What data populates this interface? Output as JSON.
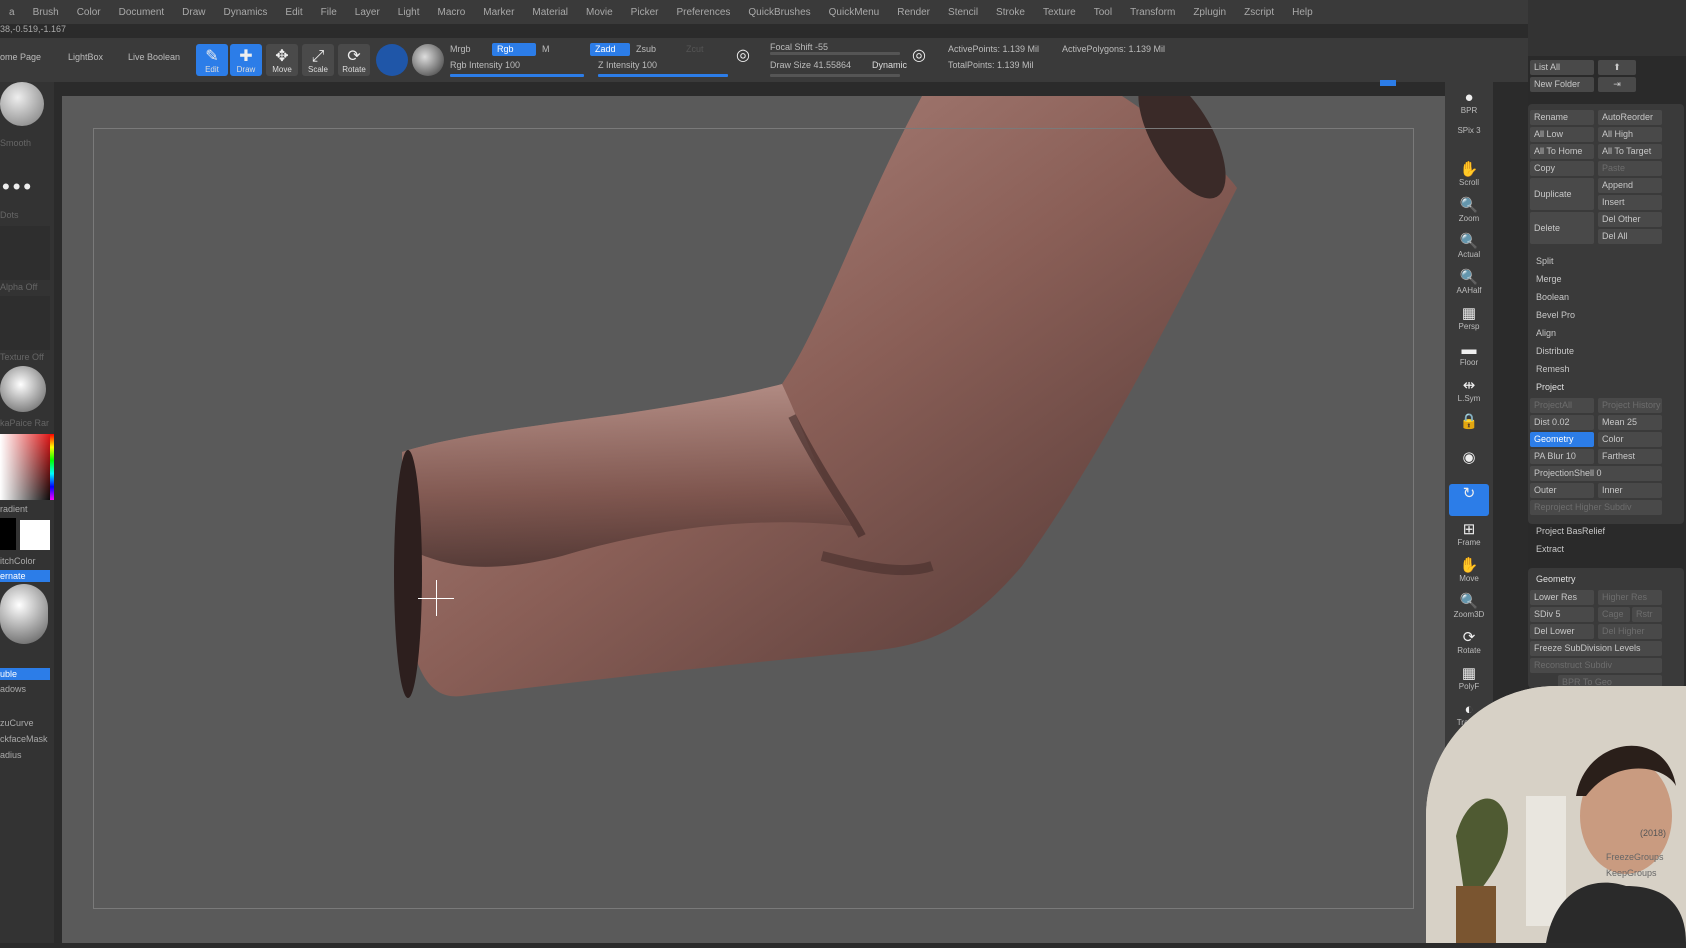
{
  "menu": [
    "a",
    "Brush",
    "Color",
    "Document",
    "Draw",
    "Dynamics",
    "Edit",
    "File",
    "Layer",
    "Light",
    "Macro",
    "Marker",
    "Material",
    "Movie",
    "Picker",
    "Preferences",
    "QuickBrushes",
    "QuickMenu",
    "Render",
    "Stencil",
    "Stroke",
    "Texture",
    "Tool",
    "Transform",
    "Zplugin",
    "Zscript",
    "Help"
  ],
  "coords": "38,-0.519,-1.167",
  "toolbar": {
    "home": "ome Page",
    "lightbox": "LightBox",
    "live_boolean": "Live Boolean",
    "edit": "Edit",
    "draw": "Draw",
    "move": "Move",
    "scale": "Scale",
    "rotate": "Rotate",
    "mrgb": "Mrgb",
    "rgb": "Rgb",
    "m": "M",
    "rgb_intensity": "Rgb Intensity 100",
    "zadd": "Zadd",
    "zsub": "Zsub",
    "zcut": "Zcut",
    "z_intensity": "Z Intensity 100",
    "focal_shift": "Focal Shift -55",
    "draw_size": "Draw Size 41.55864",
    "dynamic": "Dynamic",
    "active_points": "ActivePoints: 1.139 Mil",
    "active_polygons": "ActivePolygons: 1.139 Mil",
    "total_points": "TotalPoints: 1.139 Mil"
  },
  "left": {
    "smooth": "Smooth",
    "dots": "Dots",
    "alpha_off": "Alpha Off",
    "texture_off": "Texture Off",
    "matcap": "kaPaice Rar",
    "gradient": "radient",
    "switch_color": "itchColor",
    "alternate": "ernate",
    "double": "uble",
    "shadows": "adows",
    "lazycurve": "zuCurve",
    "backfacemask": "ckfaceMask",
    "radius": "adius"
  },
  "rtools": [
    "BPR",
    "SPix 3",
    "Scroll",
    "Zoom",
    "Actual",
    "AAHalf",
    "Persp",
    "Floor",
    "L.Sym",
    "",
    "",
    "",
    "Frame",
    "Move",
    "Zoom3D",
    "Rotate",
    "PolyF",
    "Transp"
  ],
  "rpanel": {
    "list_all": "List All",
    "new_folder": "New Folder",
    "rename": "Rename",
    "autoreorder": "AutoReorder",
    "all_low": "All Low",
    "all_high": "All High",
    "all_to_home": "All To Home",
    "all_to_target": "All To Target",
    "copy": "Copy",
    "paste": "Paste",
    "duplicate": "Duplicate",
    "append": "Append",
    "insert": "Insert",
    "delete": "Delete",
    "del_other": "Del Other",
    "del_all": "Del All",
    "split": "Split",
    "merge": "Merge",
    "boolean": "Boolean",
    "bevel_pro": "Bevel Pro",
    "align": "Align",
    "distribute": "Distribute",
    "remesh": "Remesh",
    "project": "Project",
    "projectall": "ProjectAll",
    "project_history": "Project History",
    "dist": "Dist 0.02",
    "mean": "Mean 25",
    "geometry_btn": "Geometry",
    "color": "Color",
    "pa_blur": "PA Blur 10",
    "farthest": "Farthest",
    "projection_shell": "ProjectionShell 0",
    "outer": "Outer",
    "inner": "Inner",
    "reproject": "Reproject Higher Subdiv",
    "project_basrelief": "Project BasRelief",
    "extract": "Extract",
    "geometry_header": "Geometry",
    "lower_res": "Lower Res",
    "higher_res": "Higher Res",
    "sdiv": "SDiv 5",
    "cage": "Cage",
    "rstr": "Rstr",
    "del_lower": "Del Lower",
    "del_higher": "Del Higher",
    "freeze_subdiv": "Freeze SubDivision Levels",
    "reconstruct": "Reconstruct Subdiv",
    "convert_bpr": "BPR To Geo",
    "year": "(2018)",
    "freeze_groups": "FreezeGroups",
    "keep_groups": "KeepGroups"
  }
}
